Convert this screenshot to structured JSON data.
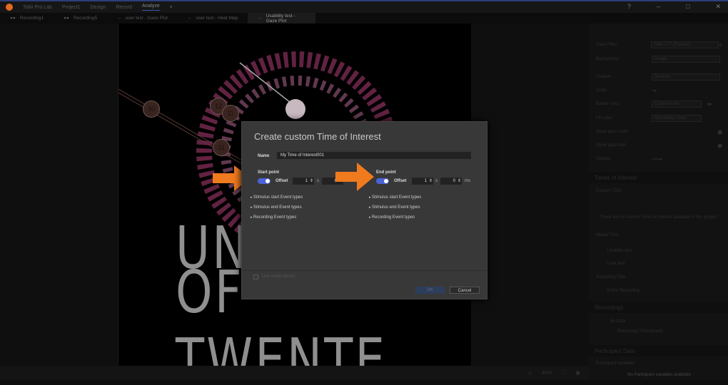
{
  "titlebar": {
    "app": "Tobii Pro Lab",
    "project": "Project1",
    "tabs": [
      "Design",
      "Record",
      "Analyze"
    ],
    "active": "Analyze"
  },
  "tabs": [
    {
      "label": "Recording1",
      "icon": "recording-icon"
    },
    {
      "label": "Recording5",
      "icon": "recording-icon"
    },
    {
      "label": "user test - Gaze Plot",
      "icon": "gaze-plot-icon"
    },
    {
      "label": "user test - Heat Map",
      "icon": "gaze-plot-icon"
    },
    {
      "label": "Usability test - Gaze Plot",
      "icon": "gaze-plot-icon",
      "selected": true
    }
  ],
  "stage": {
    "text_line1": "UNI",
    "text_line2": "OF TWENTE.",
    "fixations": [
      "30",
      "12",
      "11",
      "31"
    ]
  },
  "dialog": {
    "title": "Create custom Time of Interest",
    "name_label": "Name",
    "name_value": "My Time of Interest001",
    "start": {
      "label": "Start point",
      "offset_label": "Offset",
      "offset_on": true,
      "seconds": "1",
      "s_unit": "s",
      "ms": "0"
    },
    "end": {
      "label": "End point",
      "offset_label": "Offset",
      "offset_on": true,
      "seconds": "1",
      "s_unit": "s",
      "ms": "0",
      "ms_unit": "ms"
    },
    "event_types": [
      "Stimulus start Event types",
      "Stimulus end Event types",
      "Recording Event types"
    ],
    "media_library_label": "Use media library",
    "ok": "OK",
    "cancel": "Cancel"
  },
  "bottombar": {
    "zoom": "83%"
  },
  "rightpanel": {
    "settings": [
      {
        "label": "Gaze Filter",
        "value": "Tobii I-VT (Fixation)"
      },
      {
        "label": "Background",
        "value": "Image"
      },
      {
        "label": "Fixation",
        "value": "Duration"
      },
      {
        "label": "Scale",
        "value": ""
      },
      {
        "label": "Border color",
        "value": "Custom color"
      },
      {
        "label": "Fill color",
        "value": "Recording colors"
      },
      {
        "label": "Show gaze order",
        "value": ""
      },
      {
        "label": "Show gaze trail",
        "value": ""
      },
      {
        "label": "Opacity",
        "value": ""
      }
    ],
    "toi_title": "Times of Interest",
    "custom_tois": "Custom TOIs",
    "no_tois": "There are no custom Times of Interest available in this project.",
    "media_tois": "Media TOIs",
    "media_items": [
      "Usability test",
      "User test"
    ],
    "recording_tois": "Recording TOIs",
    "recording_items": [
      "Entire Recording"
    ],
    "recordings_title": "Recordings",
    "all_data": "All Data",
    "recording_item": "Recording1  Participant1",
    "participant_title": "Participant Data",
    "participant_vars": "Participant variables",
    "no_vars": "No Participant variables available"
  },
  "colors": {
    "accent": "#4b63d8",
    "arrow": "#f07a1e",
    "dialog_bg": "#383838"
  }
}
